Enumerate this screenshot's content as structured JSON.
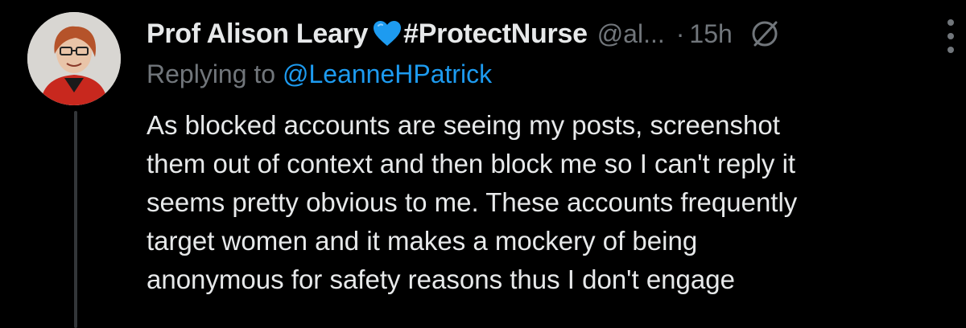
{
  "tweet": {
    "author": {
      "display_name": "Prof Alison Leary",
      "heart_icon": "blue-heart-icon",
      "hashtag": "#ProtectNurse",
      "handle": "@al...",
      "avatar_icon": "user-avatar"
    },
    "separator": "·",
    "timestamp": "15h",
    "status_icon": "no-sign-icon",
    "menu_icon": "more-vertical-icon",
    "reply_prefix": "Replying to",
    "reply_to": "@LeanneHPatrick",
    "body": "As blocked accounts are seeing my posts, screenshot\nthem out of context and then block me so I can't reply it\nseems pretty obvious to me.  These accounts frequently\ntarget women and it makes a mockery of being\nanonymous for safety reasons thus I don't engage"
  },
  "colors": {
    "background": "#000000",
    "text_primary": "#e7e9ea",
    "text_secondary": "#71767b",
    "link": "#1d9bf0",
    "heart": "#1d9bf0",
    "thread_line": "#333639"
  }
}
